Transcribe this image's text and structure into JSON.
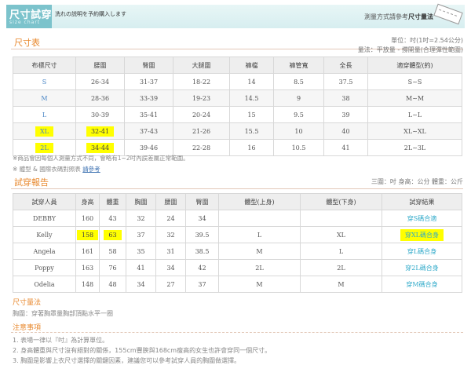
{
  "banner": {
    "title": "尺寸試穿",
    "subtitle": "size chart",
    "note": "洗れの説明を予約購入します",
    "right_prefix": "測量方式請參考",
    "right_bold": "尺寸量法"
  },
  "size_chart": {
    "title": "尺寸表",
    "unit_note": "單位：吋(1吋=2.54公分)",
    "method_note": "量法：平放量 - 撐開量(合理彈性範圍)",
    "headers": [
      "布標尺寸",
      "腰圍",
      "臀圍",
      "大腿圍",
      "褲檔",
      "褲管寬",
      "全長",
      "適穿體型(約)"
    ],
    "rows": [
      [
        "S",
        "26-34",
        "31-37",
        "18-22",
        "14",
        "8.5",
        "37.5",
        "S~S"
      ],
      [
        "M",
        "28-36",
        "33-39",
        "19-23",
        "14.5",
        "9",
        "38",
        "M~M"
      ],
      [
        "L",
        "30-39",
        "35-41",
        "20-24",
        "15",
        "9.5",
        "39",
        "L~L"
      ],
      [
        "XL",
        "32-41",
        "37-43",
        "21-26",
        "15.5",
        "10",
        "40",
        "XL~XL"
      ],
      [
        "2L",
        "34-44",
        "39-46",
        "22-28",
        "16",
        "10.5",
        "41",
        "2L~3L"
      ]
    ],
    "highlighted_rows": [
      3,
      4
    ],
    "note1": "※商品會因每個人測量方式不同，會略有1~2吋內誤差屬正常範圍。",
    "note2_prefix": "※ 體型 & 國際衣碼對照表",
    "note2_link": "請參考"
  },
  "fitting": {
    "title": "試穿報告",
    "unit_note": "三圍：吋 身高：公分 體重：公斤",
    "headers": [
      "試穿人員",
      "身高",
      "體重",
      "胸圍",
      "腰圍",
      "臀圍",
      "體型(上身)",
      "體型(下身)",
      "試穿結果"
    ],
    "rows": [
      [
        "DEBBY",
        "160",
        "43",
        "32",
        "24",
        "34",
        "",
        "",
        "穿S碼合適"
      ],
      [
        "Kelly",
        "158",
        "63",
        "37",
        "32",
        "39.5",
        "L",
        "XL",
        "穿XL碼合身"
      ],
      [
        "Angela",
        "161",
        "58",
        "35",
        "31",
        "38.5",
        "M",
        "L",
        "穿L碼合身"
      ],
      [
        "Poppy",
        "163",
        "76",
        "41",
        "34",
        "42",
        "2L",
        "2L",
        "穿2L碼合身"
      ],
      [
        "Odelia",
        "148",
        "48",
        "34",
        "27",
        "37",
        "M",
        "M",
        "穿M碼合身"
      ]
    ]
  },
  "measure": {
    "title": "尺寸量法",
    "text": "胸圍：穿著胸罩量胸部頂點水平一圈"
  },
  "notice": {
    "title": "注意事項",
    "items": [
      "1. 表場一律以『吋』為計算單位。",
      "2. 身高體重與尺寸沒有絕對的關係，155cm豐腴與168cm瘦高的女生也許會穿同一個尺寸。",
      "3. 胸圍是影響上衣尺寸選擇的關鍵因素，建議您可以參考試穿人員的胸圍做選擇。"
    ]
  }
}
